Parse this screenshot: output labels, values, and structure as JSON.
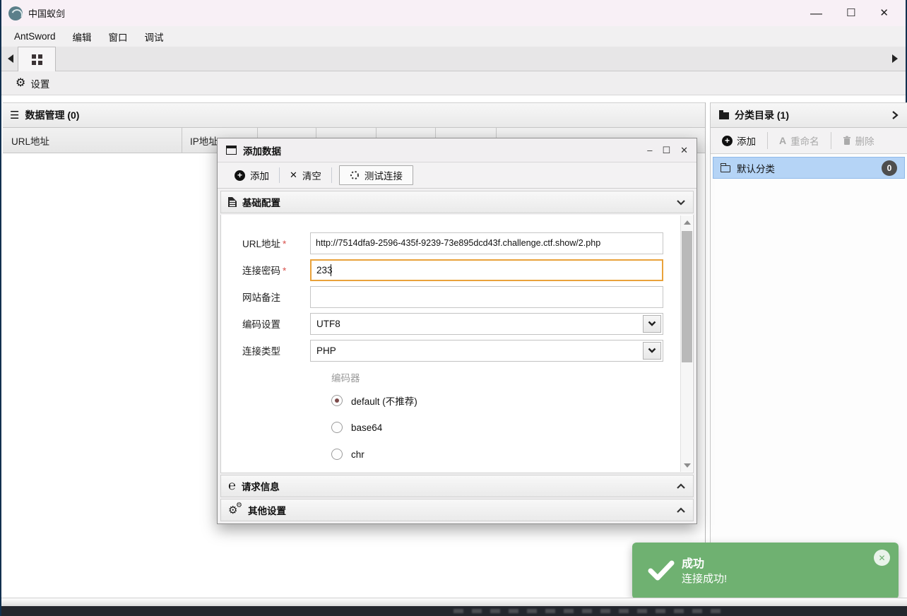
{
  "window": {
    "title": "中国蚁剑",
    "controls": {
      "minimize": "—",
      "maximize": "☐",
      "close": "✕"
    }
  },
  "menubar": {
    "items": [
      "AntSword",
      "编辑",
      "窗口",
      "调试"
    ]
  },
  "quickbar": {
    "settings_label": "设置"
  },
  "data_panel": {
    "title": "数据管理 (0)",
    "columns": [
      "URL地址",
      "IP地址"
    ]
  },
  "category_panel": {
    "title": "分类目录 (1)",
    "toolbar": {
      "add": "添加",
      "rename": "重命名",
      "delete": "删除"
    },
    "items": [
      {
        "label": "默认分类",
        "count": "0"
      }
    ]
  },
  "dialog": {
    "title": "添加数据",
    "controls": {
      "minimize": "–",
      "maximize": "☐",
      "close": "✕"
    },
    "toolbar": {
      "add": "添加",
      "clear": "清空",
      "test": "测试连接"
    },
    "sections": {
      "basic": "基础配置",
      "request": "请求信息",
      "other": "其他设置"
    },
    "form": {
      "url": {
        "label": "URL地址",
        "required": "*",
        "value": "http://7514dfa9-2596-435f-9239-73e895dcd43f.challenge.ctf.show/2.php"
      },
      "password": {
        "label": "连接密码",
        "required": "*",
        "value": "233"
      },
      "note": {
        "label": "网站备注",
        "value": ""
      },
      "encoding": {
        "label": "编码设置",
        "value": "UTF8"
      },
      "conn_type": {
        "label": "连接类型",
        "value": "PHP"
      },
      "encoder": {
        "label": "编码器",
        "options": [
          "default (不推荐)",
          "base64",
          "chr"
        ],
        "selected": "default (不推荐)"
      }
    }
  },
  "toast": {
    "title": "成功",
    "message": "连接成功!"
  },
  "colors": {
    "toast_green": "#6fb171",
    "focus_orange": "#e9a23b",
    "selection_blue": "#b5d4f6",
    "titlebar_pink": "#f8f0f6"
  }
}
